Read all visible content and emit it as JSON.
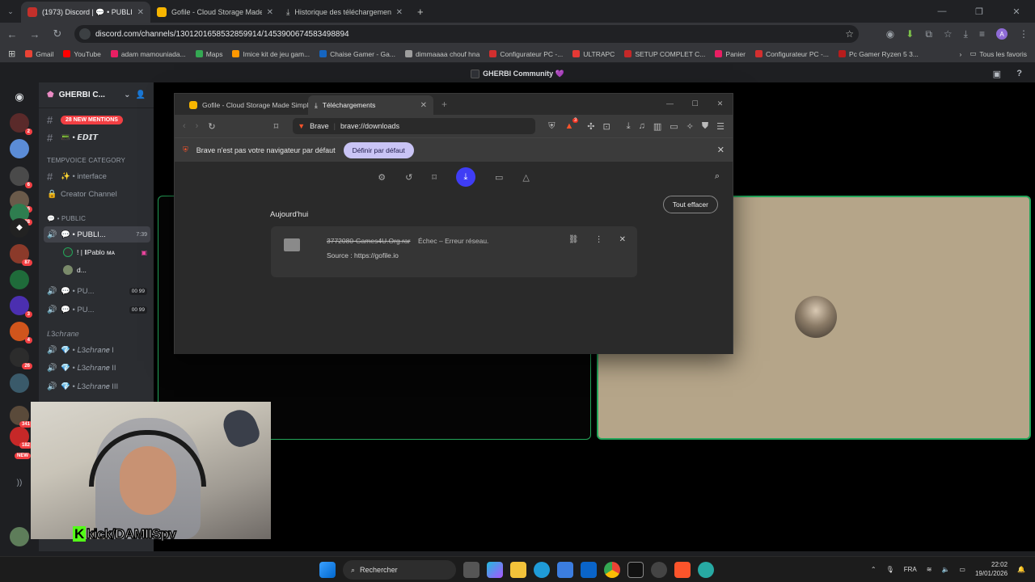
{
  "chrome": {
    "tabs": [
      {
        "title": "(1973) Discord | 💬 • PUBLI",
        "fav_color": "#c4302b"
      },
      {
        "title": "Gofile - Cloud Storage Made S",
        "fav_color": "#f7b500"
      },
      {
        "title": "Historique des téléchargements",
        "fav_color": "#9aa0a6"
      }
    ],
    "url": "discord.com/channels/1301201658532859914/1453900674583498894",
    "bookmarks": [
      {
        "label": "Gmail",
        "color": "#ea4335"
      },
      {
        "label": "YouTube",
        "color": "#ff0000"
      },
      {
        "label": "adam mamouniada...",
        "color": "#e91e63"
      },
      {
        "label": "Maps",
        "color": "#34a853"
      },
      {
        "label": "Imice kit de jeu gam...",
        "color": "#ff9800"
      },
      {
        "label": "Chaise Gamer - Ga...",
        "color": "#1565c0"
      },
      {
        "label": "dimmaaaa chouf hna",
        "color": "#9e9e9e"
      },
      {
        "label": "Configurateur PC -...",
        "color": "#d32f2f"
      },
      {
        "label": "ULTRAPC",
        "color": "#e53935"
      },
      {
        "label": "SETUP COMPLET C...",
        "color": "#c62828"
      },
      {
        "label": "Panier",
        "color": "#e91e63"
      },
      {
        "label": "Configurateur PC -...",
        "color": "#d32f2f"
      },
      {
        "label": "Pc Gamer Ryzen 5 3...",
        "color": "#b71c1c"
      }
    ],
    "all_bookmarks": "Tous les favoris"
  },
  "discord": {
    "window_title": "GHERBI Community 💜",
    "server_name": "GHERBI C...",
    "mentions_label": "28 NEW MENTIONS",
    "channels": [
      {
        "icon": "#",
        "label": "📟 • 𝙀𝘿𝙄𝙏"
      },
      {
        "category": "TEMPVOICE CATEGORY"
      },
      {
        "icon": "#",
        "label": "✨ • interface"
      },
      {
        "icon": "🔒",
        "label": "Creator Channel"
      },
      {
        "category": "💬 • PUBLIC"
      },
      {
        "icon": "🔊",
        "label": "💬 • PUBLI...",
        "extra": "7:39"
      },
      {
        "user": "! | ‖Pablo ᴍᴀ"
      },
      {
        "user": "d..."
      },
      {
        "icon": "🔊",
        "label": "💬 • PU...",
        "extra": "00 99"
      },
      {
        "icon": "🔊",
        "label": "💬 • PU...",
        "extra": "00 99"
      },
      {
        "category": "𝐿3𝑐ℎ𝑟𝑎𝑛𝑒"
      },
      {
        "icon": "🔊",
        "label": "💎 • 𝐿3𝑐ℎ𝑟𝑎𝑛𝑒 I"
      },
      {
        "icon": "🔊",
        "label": "💎 • 𝐿3𝑐ℎ𝑟𝑎𝑛𝑒 II"
      },
      {
        "icon": "🔊",
        "label": "💎 • 𝐿3𝑐ℎ𝑟𝑎𝑛𝑒 III"
      }
    ],
    "guild_badges": [
      "2",
      "6",
      "26",
      "28",
      "87",
      "3",
      "4",
      "26",
      "341",
      "182",
      "NEW"
    ]
  },
  "overlay": {
    "kick_tag": "kick/DAMIISpv",
    "kick_letter": "K"
  },
  "brave": {
    "tabs": [
      {
        "title": "Gofile - Cloud Storage Made Simple"
      },
      {
        "title": "Téléchargements"
      }
    ],
    "brand": "Brave",
    "url": "brave://downloads",
    "shield_badge": "3",
    "infobar_text": "Brave n'est pas votre navigateur par défaut",
    "set_default_label": "Définir par défaut",
    "clear_all_label": "Tout effacer",
    "section_label": "Aujourd'hui",
    "download": {
      "filename": "3772080-Games4U.Org.rar",
      "status": "Échec – Erreur réseau.",
      "source": "Source : https://gofile.io"
    }
  },
  "taskbar": {
    "search_label": "Rechercher",
    "language": "FRA",
    "time": "22:02",
    "date": "19/01/2026"
  }
}
